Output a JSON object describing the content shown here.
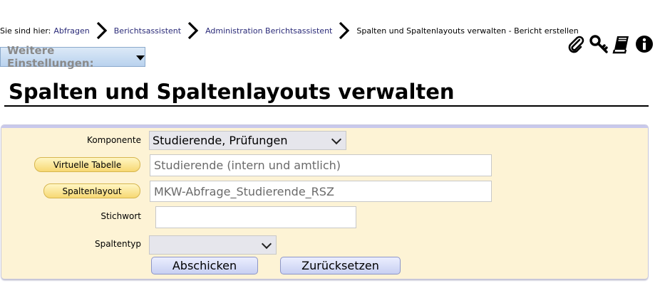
{
  "breadcrumb": {
    "prefix": "Sie sind hier:",
    "items": [
      "Abfragen",
      "Berichtsassistent",
      "Administration Berichtsassistent"
    ],
    "current": "Spalten und Spaltenlayouts verwalten - Bericht erstellen"
  },
  "top_icons": [
    "paperclip-icon",
    "key-icon",
    "book-icon",
    "info-icon"
  ],
  "settings": {
    "label": "Weitere Einstellungen:"
  },
  "page": {
    "title": "Spalten und Spaltenlayouts verwalten"
  },
  "form": {
    "komponente": {
      "label": "Komponente",
      "value": "Studierende, Prüfungen"
    },
    "virtuelle_tabelle": {
      "button": "Virtuelle Tabelle",
      "value": "Studierende (intern und amtlich)"
    },
    "spaltenlayout": {
      "button": "Spaltenlayout",
      "value": "MKW-Abfrage_Studierende_RSZ"
    },
    "stichwort": {
      "label": "Stichwort",
      "value": ""
    },
    "spaltentyp": {
      "label": "Spaltentyp",
      "value": ""
    },
    "submit": "Abschicken",
    "reset": "Zurücksetzen"
  },
  "colors": {
    "panel_bg": "#fdf3d5",
    "panel_border": "#c8c8ec",
    "link": "#2a2a78",
    "button_bg": "#c8d0f2",
    "pill_bg": "#f7d873"
  }
}
